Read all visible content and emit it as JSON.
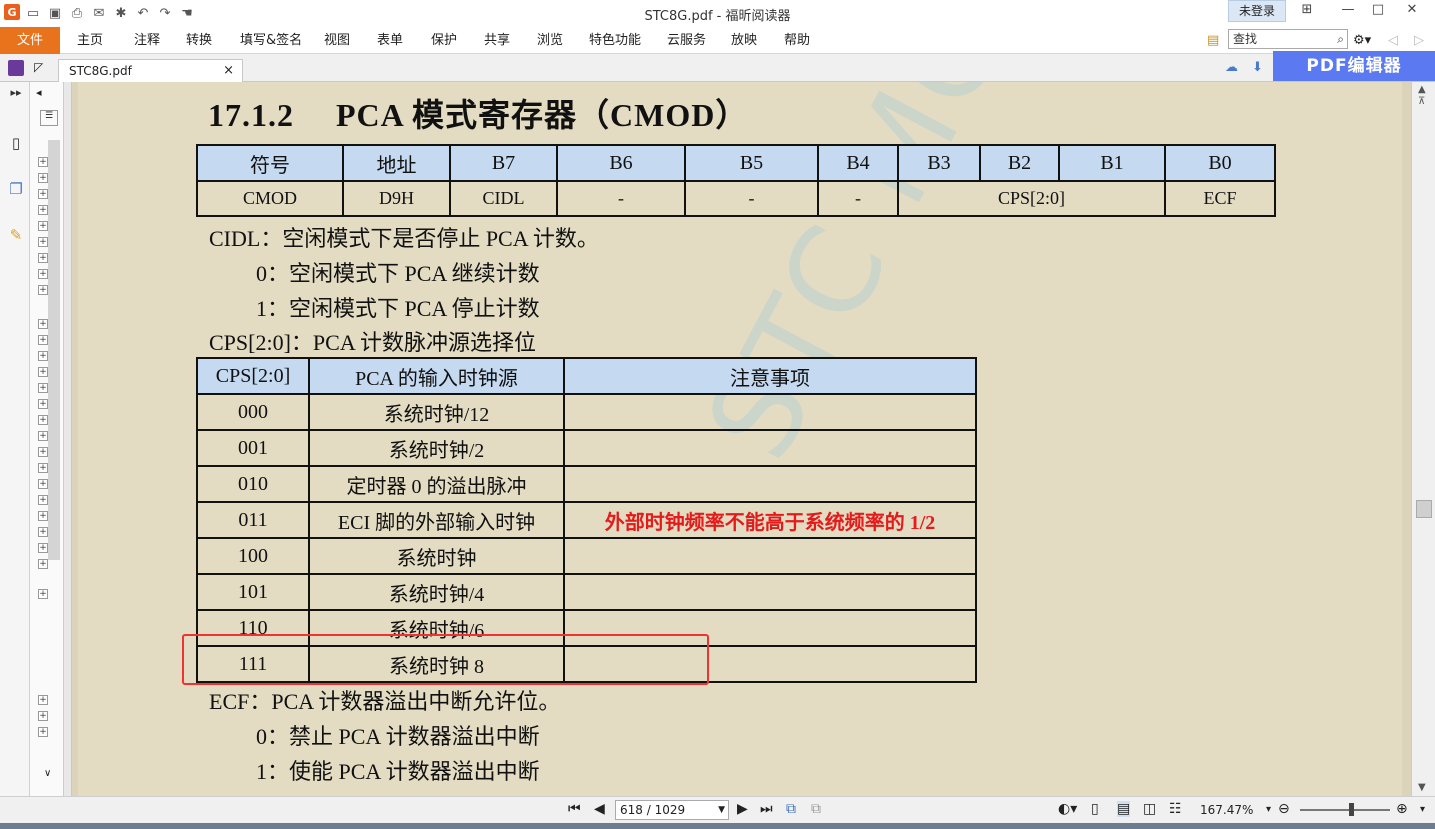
{
  "window": {
    "title": "STC8G.pdf - 福昕阅读器",
    "login": "未登录",
    "minimize": "—",
    "maximize": "□",
    "close": "✕"
  },
  "toolbar_icons": [
    "app-logo",
    "open-icon",
    "save-icon",
    "print-icon",
    "email-icon",
    "new-icon",
    "undo-icon",
    "redo-icon",
    "hand-icon"
  ],
  "menu": {
    "file": "文件",
    "items": [
      "主页",
      "注释",
      "转换",
      "填写&签名",
      "视图",
      "表单",
      "保护",
      "共享",
      "浏览",
      "特色功能",
      "云服务",
      "放映",
      "帮助"
    ]
  },
  "search": {
    "placeholder": "查找"
  },
  "tab": {
    "label": "STC8G.pdf",
    "close": "×"
  },
  "edit_button": "PDF编辑器",
  "document": {
    "heading_num": "17.1.2",
    "heading_text": "PCA 模式寄存器（CMOD）",
    "reg_table": {
      "headers": [
        "符号",
        "地址",
        "B7",
        "B6",
        "B5",
        "B4",
        "B3",
        "B2",
        "B1",
        "B0"
      ],
      "values": [
        "CMOD",
        "D9H",
        "CIDL",
        "-",
        "-",
        "-",
        "CPS[2:0]",
        "ECF"
      ]
    },
    "cidl_title": "CIDL：空闲模式下是否停止 PCA 计数。",
    "cidl_0": "0：空闲模式下 PCA 继续计数",
    "cidl_1": "1：空闲模式下 PCA 停止计数",
    "cps_title": "CPS[2:0]：PCA 计数脉冲源选择位",
    "cps_table": {
      "headers": [
        "CPS[2:0]",
        "PCA 的输入时钟源",
        "注意事项"
      ],
      "rows": [
        [
          "000",
          "系统时钟/12",
          ""
        ],
        [
          "001",
          "系统时钟/2",
          ""
        ],
        [
          "010",
          "定时器 0 的溢出脉冲",
          ""
        ],
        [
          "011",
          "ECI 脚的外部输入时钟",
          "外部时钟频率不能高于系统频率的 1/2"
        ],
        [
          "100",
          "系统时钟",
          ""
        ],
        [
          "101",
          "系统时钟/4",
          ""
        ],
        [
          "110",
          "系统时钟/6",
          ""
        ],
        [
          "111",
          "系统时钟 8",
          ""
        ]
      ]
    },
    "ecf_title": "ECF：PCA 计数器溢出中断允许位。",
    "ecf_0": "0：禁止 PCA 计数器溢出中断",
    "ecf_1": "1：使能 PCA 计数器溢出中断",
    "watermark": "STC MCU"
  },
  "status": {
    "page": "618 / 1029",
    "zoom": "167.47%"
  },
  "colors": {
    "file_menu": "#e8731c",
    "edit_button": "#5b79f0",
    "table_header": "#c5d9f1",
    "note_text": "#e31b1b",
    "highlight_box": "#ee3333",
    "page_bg": "#e3dcc3"
  }
}
